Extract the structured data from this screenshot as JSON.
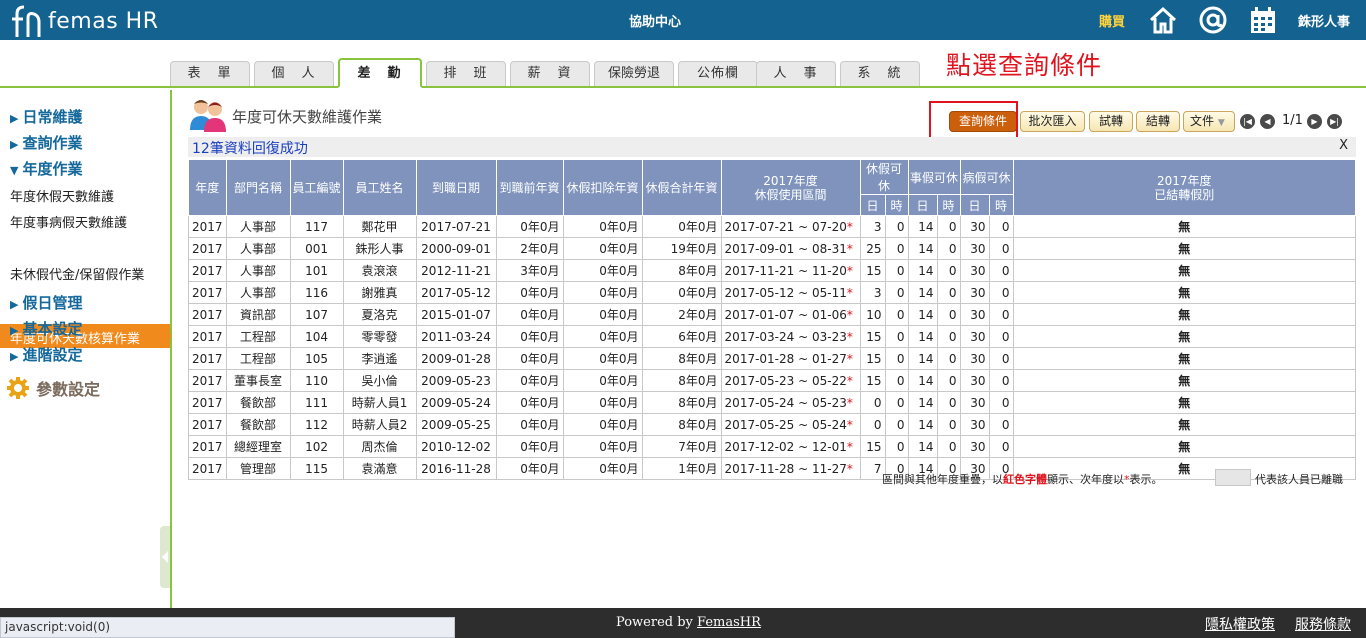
{
  "header": {
    "logo_text": "femas HR",
    "help_center": "協助中心",
    "buy": "購買",
    "username": "銖形人事",
    "icons": [
      "home-icon",
      "at-icon",
      "calendar-icon"
    ]
  },
  "tabs": [
    {
      "label": "表　單"
    },
    {
      "label": "個　人"
    },
    {
      "label": "差　勤"
    },
    {
      "label": "排　班"
    },
    {
      "label": "薪　資"
    },
    {
      "label": "保險勞退"
    },
    {
      "label": "公佈欄"
    },
    {
      "label": "人　事"
    },
    {
      "label": "系　統"
    }
  ],
  "active_tab": "差　勤",
  "annotation": "點選查詢條件",
  "sidebar": {
    "sections": [
      {
        "label": "日常維護",
        "expanded": false
      },
      {
        "label": "查詢作業",
        "expanded": false
      },
      {
        "label": "年度作業",
        "expanded": true
      }
    ],
    "sub_items": [
      {
        "label": "年度休假天數維護"
      },
      {
        "label": "年度事病假天數維護"
      },
      {
        "label": "年度可休天數核算作業"
      },
      {
        "label": "未休假代金/保留假作業"
      }
    ],
    "more_sections": [
      {
        "label": "假日管理"
      },
      {
        "label": "基本設定"
      },
      {
        "label": "進階設定"
      }
    ],
    "param_label": "參數設定"
  },
  "page": {
    "title": "年度可休天數維護作業",
    "message": "12筆資料回復成功",
    "close": "X"
  },
  "toolbar": {
    "query": "查詢條件",
    "batch_import": "批次匯入",
    "trial": "試轉",
    "settle": "結轉",
    "docs": "文件",
    "pager": "1/1"
  },
  "table": {
    "headers": {
      "year": "年度",
      "dept": "部門名稱",
      "emp_no": "員工編號",
      "emp_name": "員工姓名",
      "hire_date": "到職日期",
      "prior_seniority": "到職前年資",
      "deduct_seniority": "休假扣除年資",
      "total_seniority": "休假合計年資",
      "period_line1": "2017年度",
      "period_line2": "休假使用區間",
      "annual": "休假可休",
      "personal": "事假可休",
      "sick": "病假可休",
      "day": "日",
      "hour": "時",
      "carry_line1": "2017年度",
      "carry_line2": "已結轉假別"
    },
    "rows": [
      {
        "year": "2017",
        "dept": "人事部",
        "no": "117",
        "name": "鄭花甲",
        "hire": "2017-07-21",
        "prior": "0年0月",
        "deduct": "0年0月",
        "total": "0年0月",
        "period": "2017-07-21 ~ 07-20",
        "ad": "3",
        "ah": "0",
        "pd": "14",
        "ph": "0",
        "sd": "30",
        "sh": "0",
        "carry": "無"
      },
      {
        "year": "2017",
        "dept": "人事部",
        "no": "001",
        "name": "銖形人事",
        "hire": "2000-09-01",
        "prior": "2年0月",
        "deduct": "0年0月",
        "total": "19年0月",
        "period": "2017-09-01 ~ 08-31",
        "ad": "25",
        "ah": "0",
        "pd": "14",
        "ph": "0",
        "sd": "30",
        "sh": "0",
        "carry": "無"
      },
      {
        "year": "2017",
        "dept": "人事部",
        "no": "101",
        "name": "袁滾滾",
        "hire": "2012-11-21",
        "prior": "3年0月",
        "deduct": "0年0月",
        "total": "8年0月",
        "period": "2017-11-21 ~ 11-20",
        "ad": "15",
        "ah": "0",
        "pd": "14",
        "ph": "0",
        "sd": "30",
        "sh": "0",
        "carry": "無"
      },
      {
        "year": "2017",
        "dept": "人事部",
        "no": "116",
        "name": "謝雅真",
        "hire": "2017-05-12",
        "prior": "0年0月",
        "deduct": "0年0月",
        "total": "0年0月",
        "period": "2017-05-12 ~ 05-11",
        "ad": "3",
        "ah": "0",
        "pd": "14",
        "ph": "0",
        "sd": "30",
        "sh": "0",
        "carry": "無"
      },
      {
        "year": "2017",
        "dept": "資訊部",
        "no": "107",
        "name": "夏洛克",
        "hire": "2015-01-07",
        "prior": "0年0月",
        "deduct": "0年0月",
        "total": "2年0月",
        "period": "2017-01-07 ~ 01-06",
        "ad": "10",
        "ah": "0",
        "pd": "14",
        "ph": "0",
        "sd": "30",
        "sh": "0",
        "carry": "無"
      },
      {
        "year": "2017",
        "dept": "工程部",
        "no": "104",
        "name": "零零發",
        "hire": "2011-03-24",
        "prior": "0年0月",
        "deduct": "0年0月",
        "total": "6年0月",
        "period": "2017-03-24 ~ 03-23",
        "ad": "15",
        "ah": "0",
        "pd": "14",
        "ph": "0",
        "sd": "30",
        "sh": "0",
        "carry": "無"
      },
      {
        "year": "2017",
        "dept": "工程部",
        "no": "105",
        "name": "李逍遙",
        "hire": "2009-01-28",
        "prior": "0年0月",
        "deduct": "0年0月",
        "total": "8年0月",
        "period": "2017-01-28 ~ 01-27",
        "ad": "15",
        "ah": "0",
        "pd": "14",
        "ph": "0",
        "sd": "30",
        "sh": "0",
        "carry": "無"
      },
      {
        "year": "2017",
        "dept": "董事長室",
        "no": "110",
        "name": "吳小倫",
        "hire": "2009-05-23",
        "prior": "0年0月",
        "deduct": "0年0月",
        "total": "8年0月",
        "period": "2017-05-23 ~ 05-22",
        "ad": "15",
        "ah": "0",
        "pd": "14",
        "ph": "0",
        "sd": "30",
        "sh": "0",
        "carry": "無"
      },
      {
        "year": "2017",
        "dept": "餐飲部",
        "no": "111",
        "name": "時薪人員1",
        "hire": "2009-05-24",
        "prior": "0年0月",
        "deduct": "0年0月",
        "total": "8年0月",
        "period": "2017-05-24 ~ 05-23",
        "ad": "0",
        "ah": "0",
        "pd": "14",
        "ph": "0",
        "sd": "30",
        "sh": "0",
        "carry": "無"
      },
      {
        "year": "2017",
        "dept": "餐飲部",
        "no": "112",
        "name": "時薪人員2",
        "hire": "2009-05-25",
        "prior": "0年0月",
        "deduct": "0年0月",
        "total": "8年0月",
        "period": "2017-05-25 ~ 05-24",
        "ad": "0",
        "ah": "0",
        "pd": "14",
        "ph": "0",
        "sd": "30",
        "sh": "0",
        "carry": "無"
      },
      {
        "year": "2017",
        "dept": "總經理室",
        "no": "102",
        "name": "周杰倫",
        "hire": "2010-12-02",
        "prior": "0年0月",
        "deduct": "0年0月",
        "total": "7年0月",
        "period": "2017-12-02 ~ 12-01",
        "ad": "15",
        "ah": "0",
        "pd": "14",
        "ph": "0",
        "sd": "30",
        "sh": "0",
        "carry": "無"
      },
      {
        "year": "2017",
        "dept": "管理部",
        "no": "115",
        "name": "袁滿意",
        "hire": "2016-11-28",
        "prior": "0年0月",
        "deduct": "0年0月",
        "total": "1年0月",
        "period": "2017-11-28 ~ 11-27",
        "ad": "7",
        "ah": "0",
        "pd": "14",
        "ph": "0",
        "sd": "30",
        "sh": "0",
        "carry": "無"
      }
    ],
    "star": "*"
  },
  "legend": {
    "prefix": "區間與其他年度重疊，以",
    "red": "紅色字體",
    "middle": "顯示、次年度以",
    "star": "*",
    "suffix": "表示。",
    "resigned": "代表該人員已離職"
  },
  "footer": {
    "status_url": "javascript:void(0)",
    "powered_prefix": "Powered by ",
    "powered_link": "FemasHR",
    "privacy": "隱私權政策",
    "terms": "服務條款"
  }
}
